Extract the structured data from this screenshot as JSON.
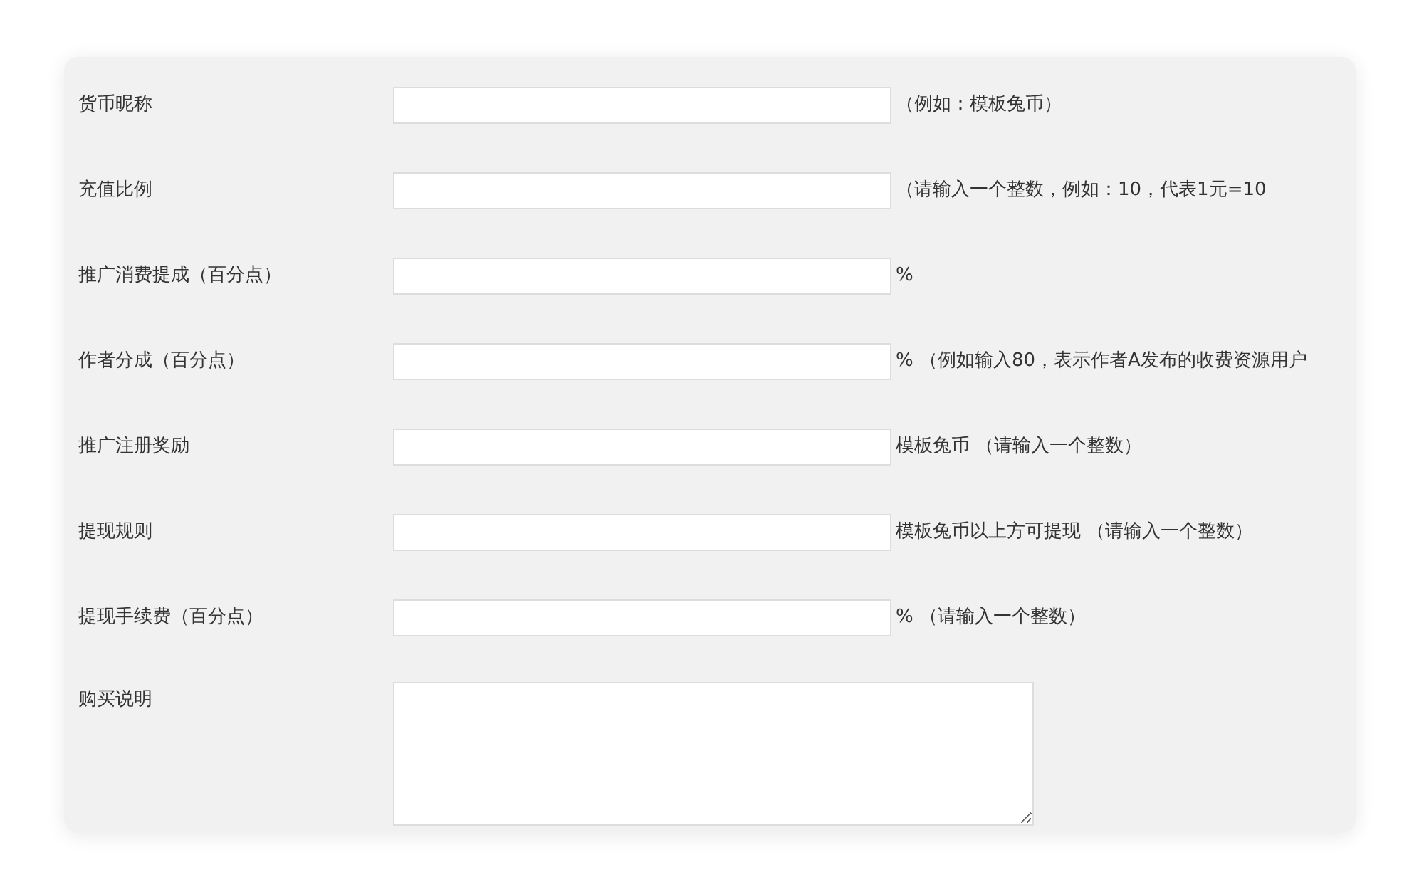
{
  "form": {
    "fields": [
      {
        "kind": "input",
        "label": "货币昵称",
        "suffix": "（例如：模板兔币）"
      },
      {
        "kind": "input",
        "label": "充值比例",
        "suffix": "（请输入一个整数，例如：10，代表1元=10"
      },
      {
        "kind": "input",
        "label": "推广消费提成（百分点）",
        "suffix": "%"
      },
      {
        "kind": "input",
        "label": "作者分成（百分点）",
        "suffix": "% （例如输入80，表示作者A发布的收费资源用户"
      },
      {
        "kind": "input",
        "label": "推广注册奖励",
        "suffix": "模板兔币 （请输入一个整数）"
      },
      {
        "kind": "input",
        "label": "提现规则",
        "suffix": "模板兔币以上方可提现 （请输入一个整数）"
      },
      {
        "kind": "input",
        "label": "提现手续费（百分点）",
        "suffix": "% （请输入一个整数）"
      },
      {
        "kind": "textarea",
        "label": "购买说明"
      }
    ]
  }
}
